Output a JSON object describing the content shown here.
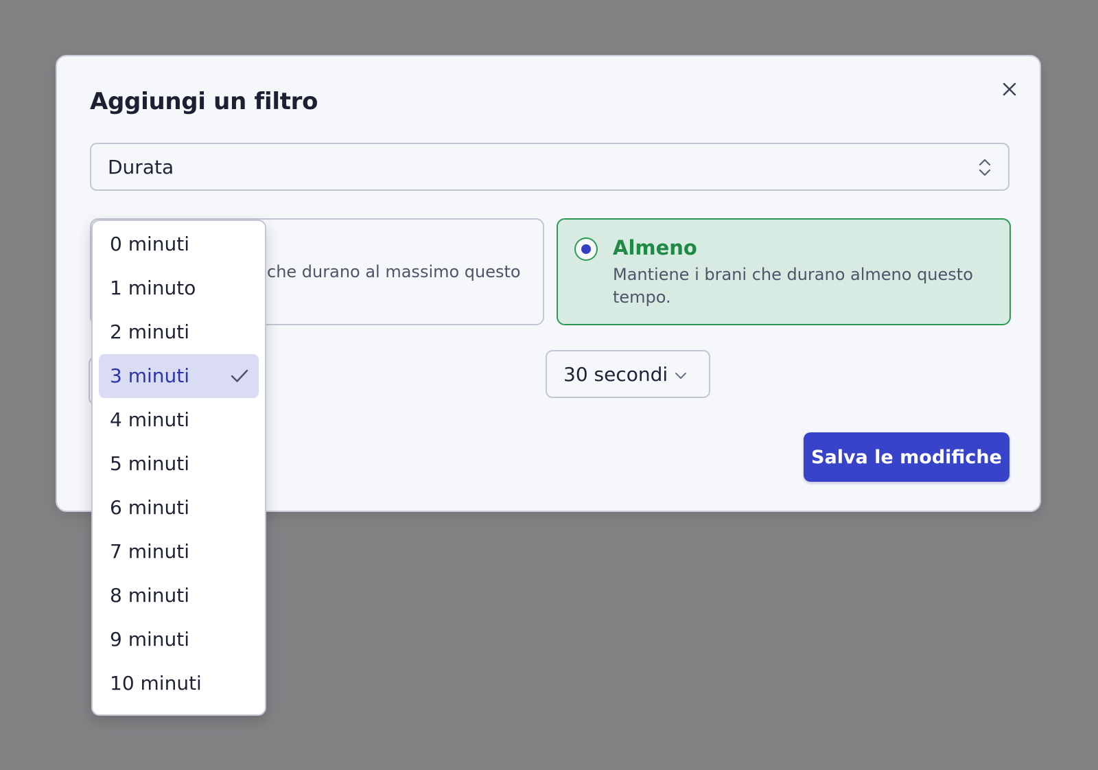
{
  "modal": {
    "title": "Aggiungi un filtro",
    "filter_type": {
      "value": "Durata"
    },
    "options": [
      {
        "id": "al-massimo",
        "visible_description": "che durano al massimo questo",
        "selected": false
      },
      {
        "id": "almeno",
        "title": "Almeno",
        "description": "Mantiene i brani che durano almeno questo tempo.",
        "selected": true
      }
    ],
    "seconds_select": {
      "value": "30 secondi"
    },
    "save_label": "Salva le modifiche"
  },
  "minutes_dropdown": {
    "selected_index": 3,
    "items": [
      "0 minuti",
      "1 minuto",
      "2 minuti",
      "3 minuti",
      "4 minuti",
      "5 minuti",
      "6 minuti",
      "7 minuti",
      "8 minuti",
      "9 minuti",
      "10 minuti"
    ]
  },
  "icons": {
    "close": "close-icon",
    "select": "chevron-up-down-icon",
    "dropdown": "chevron-down-icon",
    "selected": "check-icon"
  },
  "colors": {
    "overlay": "#838386",
    "modal_background": "#f5f7fb",
    "accent": "#3743c9",
    "success": "#1f8a45",
    "success_background": "#d8ebe3",
    "selected_item_background": "#dadcf3"
  }
}
